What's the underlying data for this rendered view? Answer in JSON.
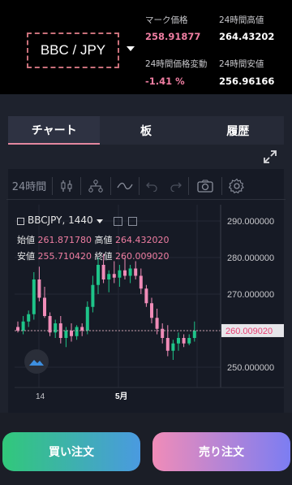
{
  "header": {
    "pair": "BBC / JPY",
    "mark_price_label": "マーク価格",
    "mark_price": "258.91877",
    "high_24h_label": "24時間高値",
    "high_24h": "264.43202",
    "change_24h_label": "24時間価格変動",
    "change_24h": "-1.41 %",
    "low_24h_label": "24時間安値",
    "low_24h": "256.96166"
  },
  "tabs": [
    "チャート",
    "板",
    "履歴"
  ],
  "toolbar": {
    "interval": "24時間"
  },
  "chart": {
    "symbol": "BBCJPY, 1440",
    "open_label": "始値",
    "open": "261.871780",
    "high_label": "高値",
    "high": "264.432020",
    "low_label": "安値",
    "low": "255.710420",
    "close_label": "終値",
    "close": "260.009020",
    "last_price": "260.009020",
    "x_labels": [
      "14",
      "5月"
    ],
    "y_labels": [
      "290.000000",
      "280.000000",
      "270.000000",
      "250.000000"
    ]
  },
  "chart_data": {
    "type": "candlestick",
    "y_ticks": [
      290,
      280,
      270,
      250
    ],
    "last_price": 260.00902,
    "candles": [
      {
        "o": 261,
        "h": 262.5,
        "l": 259.5,
        "c": 260
      },
      {
        "o": 260,
        "h": 264,
        "l": 259,
        "c": 262.5
      },
      {
        "o": 262.5,
        "h": 265.5,
        "l": 261,
        "c": 264.5
      },
      {
        "o": 264.5,
        "h": 276,
        "l": 263,
        "c": 274
      },
      {
        "o": 274,
        "h": 277.5,
        "l": 268,
        "c": 269
      },
      {
        "o": 269,
        "h": 272,
        "l": 263.5,
        "c": 264
      },
      {
        "o": 264,
        "h": 265,
        "l": 258.5,
        "c": 259.5
      },
      {
        "o": 259.5,
        "h": 263,
        "l": 258,
        "c": 262
      },
      {
        "o": 262,
        "h": 264,
        "l": 256.5,
        "c": 258
      },
      {
        "o": 258,
        "h": 261,
        "l": 255.5,
        "c": 260
      },
      {
        "o": 260,
        "h": 262,
        "l": 257,
        "c": 258.5
      },
      {
        "o": 258.5,
        "h": 261.5,
        "l": 257.5,
        "c": 261
      },
      {
        "o": 261,
        "h": 262,
        "l": 258.5,
        "c": 260
      },
      {
        "o": 260,
        "h": 268,
        "l": 259,
        "c": 266.5
      },
      {
        "o": 266.5,
        "h": 275,
        "l": 265,
        "c": 272.5
      },
      {
        "o": 272.5,
        "h": 280,
        "l": 270,
        "c": 278
      },
      {
        "o": 278,
        "h": 281,
        "l": 273,
        "c": 274
      },
      {
        "o": 274,
        "h": 276.5,
        "l": 270.5,
        "c": 275.5
      },
      {
        "o": 275.5,
        "h": 279,
        "l": 273,
        "c": 274.5
      },
      {
        "o": 274.5,
        "h": 278,
        "l": 272,
        "c": 276.5
      },
      {
        "o": 276.5,
        "h": 280,
        "l": 274,
        "c": 275
      },
      {
        "o": 275,
        "h": 278,
        "l": 273,
        "c": 277
      },
      {
        "o": 277,
        "h": 279,
        "l": 274,
        "c": 275
      },
      {
        "o": 275,
        "h": 277,
        "l": 270,
        "c": 271.5
      },
      {
        "o": 271.5,
        "h": 272.5,
        "l": 266.5,
        "c": 267.5
      },
      {
        "o": 267.5,
        "h": 269,
        "l": 262,
        "c": 263.5
      },
      {
        "o": 263.5,
        "h": 266,
        "l": 259,
        "c": 260.5
      },
      {
        "o": 260.5,
        "h": 262,
        "l": 256.5,
        "c": 258
      },
      {
        "o": 258,
        "h": 261.5,
        "l": 253,
        "c": 254.5
      },
      {
        "o": 254.5,
        "h": 257.5,
        "l": 252,
        "c": 256.5
      },
      {
        "o": 256.5,
        "h": 259.5,
        "l": 254.5,
        "c": 258
      },
      {
        "o": 258,
        "h": 259,
        "l": 255.5,
        "c": 256.5
      },
      {
        "o": 256.5,
        "h": 259,
        "l": 256,
        "c": 258
      },
      {
        "o": 258,
        "h": 262.5,
        "l": 257,
        "c": 260
      }
    ]
  },
  "buttons": {
    "buy": "買い注文",
    "sell": "売り注文"
  }
}
